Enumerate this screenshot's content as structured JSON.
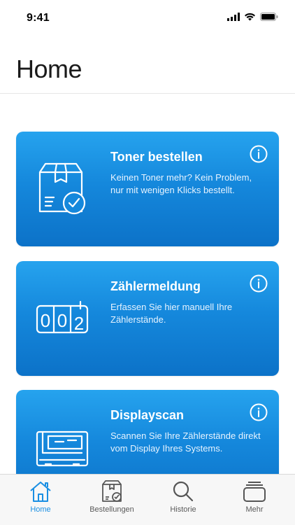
{
  "status_bar": {
    "time": "9:41"
  },
  "header": {
    "title": "Home"
  },
  "cards": [
    {
      "title": "Toner bestellen",
      "description": "Keinen Toner mehr? Kein Problem, nur mit wenigen Klicks bestellt.",
      "icon": "package-check-icon"
    },
    {
      "title": "Zählermeldung",
      "description": "Erfassen Sie hier manuell Ihre Zählerstände.",
      "icon": "counter-icon"
    },
    {
      "title": "Displayscan",
      "description": "Scannen Sie Ihre Zählerstände direkt vom Display Ihres Systems.",
      "icon": "display-scan-icon"
    }
  ],
  "counter_digits": [
    "0",
    "0",
    "2"
  ],
  "tabs": [
    {
      "label": "Home",
      "icon": "home-icon",
      "active": true
    },
    {
      "label": "Bestellungen",
      "icon": "package-icon",
      "active": false
    },
    {
      "label": "Historie",
      "icon": "search-icon",
      "active": false
    },
    {
      "label": "Mehr",
      "icon": "stack-icon",
      "active": false
    }
  ],
  "colors": {
    "accent": "#1a8fe3",
    "card_top": "#26a3ee",
    "card_bottom": "#0c72c8",
    "tab_inactive": "#5a5a5a"
  }
}
